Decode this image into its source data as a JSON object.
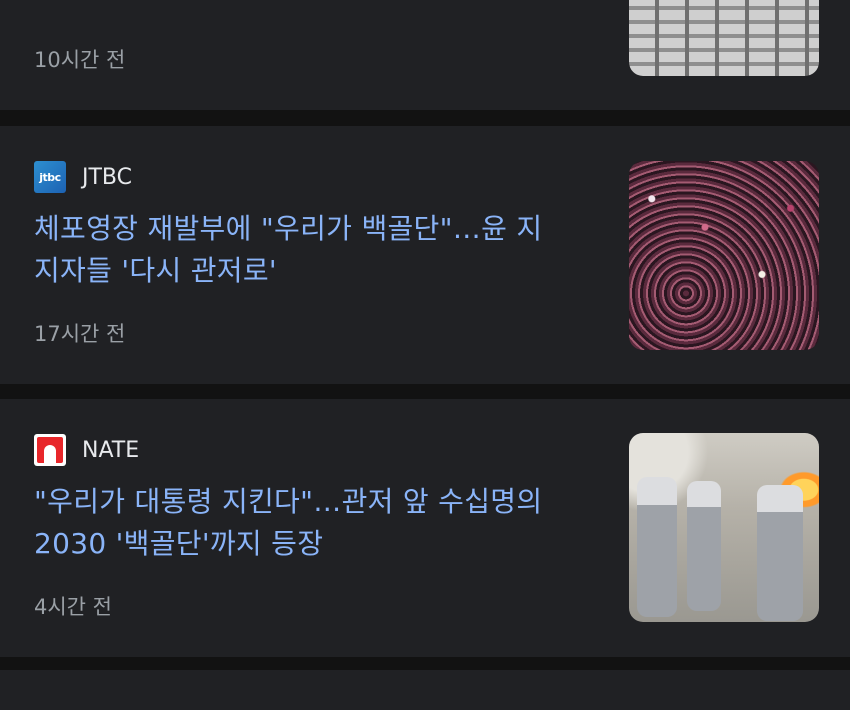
{
  "cards": [
    {
      "headline": "...",
      "time": "10시간 전"
    },
    {
      "source": "JTBC",
      "logo_text": "jtbc",
      "headline_line1": "체포영장 재발부에 \"우리가 백골단\"…윤 지",
      "headline_line2": "지자들 '다시 관저로'",
      "time": "17시간 전"
    },
    {
      "source": "NATE",
      "headline_line1": "\"우리가 대통령 지킨다\"…관저 앞 수십명의",
      "headline_line2": "2030 '백골단'까지 등장",
      "time": "4시간 전"
    }
  ],
  "colors": {
    "background": "#121212",
    "card": "#202124",
    "headline": "#8ab4f8",
    "meta": "#9aa0a6",
    "source": "#e8eaed"
  }
}
